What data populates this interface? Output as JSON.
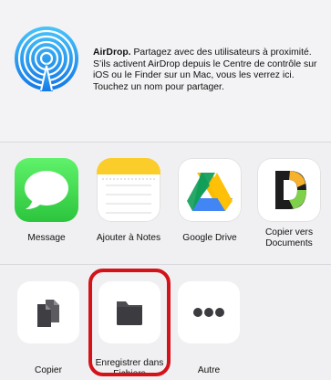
{
  "airdrop": {
    "title": "AirDrop.",
    "description": " Partagez avec des utilisateurs à proximité. S’ils activent AirDrop depuis le Centre de contrôle sur iOS ou le Finder sur un Mac, vous les verrez ici. Touchez un nom pour partager."
  },
  "apps": [
    {
      "label": "Message",
      "icon": "messages-icon"
    },
    {
      "label": "Ajouter à Notes",
      "icon": "notes-icon"
    },
    {
      "label": "Google Drive",
      "icon": "google-drive-icon"
    },
    {
      "label": "Copier vers Documents",
      "icon": "documents-icon"
    }
  ],
  "actions": [
    {
      "label": "Copier",
      "icon": "copy-icon"
    },
    {
      "label": "Enregistrer dans Fichiers",
      "icon": "folder-icon"
    },
    {
      "label": "Autre",
      "icon": "more-icon"
    }
  ],
  "colors": {
    "messages_green": "#3ddc4f",
    "airdrop_blue": "#1e9bf0",
    "highlight_red": "#d3121a"
  }
}
